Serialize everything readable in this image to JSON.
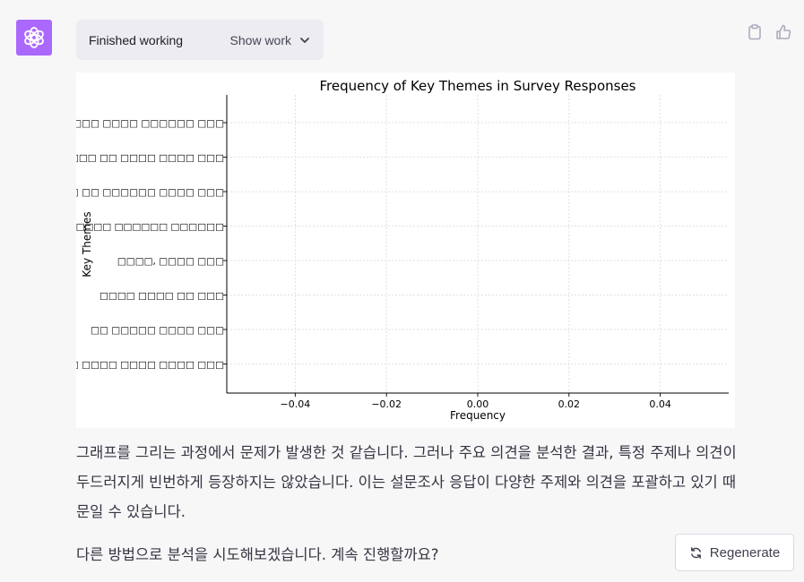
{
  "assistant": {
    "avatar_icon": "openai-logo-icon",
    "avatar_color": "#ab68ff"
  },
  "status": {
    "label": "Finished working",
    "show_work_label": "Show work"
  },
  "actions": {
    "copy_icon": "clipboard-icon",
    "like_icon": "thumbs-up-icon"
  },
  "chart_data": {
    "type": "bar",
    "orientation": "horizontal",
    "title": "Frequency of Key Themes in Survey Responses",
    "xlabel": "Frequency",
    "ylabel": "Key Themes",
    "xlim": [
      -0.055,
      0.055
    ],
    "xticks": [
      -0.04,
      -0.02,
      0.0,
      0.02,
      0.04
    ],
    "xtick_labels": [
      "−0.04",
      "−0.02",
      "0.00",
      "0.02",
      "0.04"
    ],
    "categories": [
      "□□□□□□□ □□□□ □□□□□□ □□□",
      "□□□□ □□ □□□□ □□□□ □□□",
      "□□□□ □□□□ □□ □□□□□□ □□□□ □□□",
      "□□□□ □□□□ □□□□□□ □□□□□□",
      "□□□□, □□□□ □□□",
      "□□□□ □□□□ □□ □□□",
      "□□ □□□□□ □□□□ □□□",
      "□□□□□ □□□□ □□□□ □□□□ □□□"
    ],
    "values": [
      0,
      0,
      0,
      0,
      0,
      0,
      0,
      0
    ],
    "grid": true
  },
  "message": {
    "paragraph1": "그래프를 그리는 과정에서 문제가 발생한 것 같습니다. 그러나 주요 의견을 분석한 결과, 특정 주제나 의견이 두드러지게 빈번하게 등장하지는 않았습니다. 이는 설문조사 응답이 다양한 주제와 의견을 포괄하고 있기 때문일 수 있습니다.",
    "paragraph2": "다른 방법으로 분석을 시도해보겠습니다. 계속 진행할까요?"
  },
  "regenerate": {
    "label": "Regenerate",
    "icon": "refresh-icon"
  }
}
